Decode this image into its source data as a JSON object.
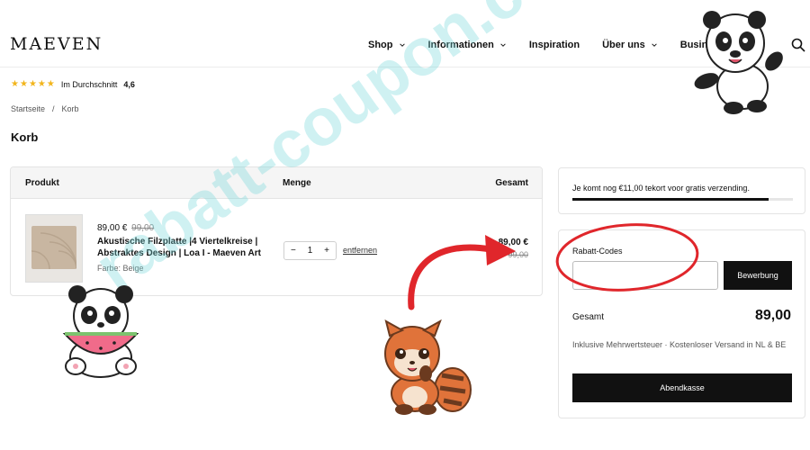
{
  "header": {
    "logo": "MAEVEN",
    "nav": [
      {
        "label": "Shop",
        "has_dropdown": true
      },
      {
        "label": "Informationen",
        "has_dropdown": true
      },
      {
        "label": "Inspiration",
        "has_dropdown": false
      },
      {
        "label": "Über uns",
        "has_dropdown": true
      },
      {
        "label": "Business",
        "has_dropdown": false
      }
    ],
    "search_icon": "search-icon"
  },
  "rating": {
    "text": "Im Durchschnitt",
    "score": "4,6",
    "stars": 5,
    "star_color": "#f2b51c"
  },
  "breadcrumb": {
    "home": "Startseite",
    "separator": "/",
    "current": "Korb"
  },
  "page": {
    "title": "Korb"
  },
  "cart": {
    "headers": {
      "product": "Produkt",
      "quantity": "Menge",
      "total": "Gesamt"
    },
    "items": [
      {
        "price": "89,00 €",
        "old_price": "99,00",
        "name": "Akustische Filzplatte |4 Viertelkreise | Abstraktes Design | Loa I - Maeven Art",
        "variant": "Farbe: Beige",
        "quantity": "1",
        "remove_label": "entfernen",
        "total": "89,00 €",
        "old_total": "99,00"
      }
    ]
  },
  "shipping": {
    "message": "Je komt nog €11,00 tekort voor gratis verzending.",
    "progress": 0.89
  },
  "summary": {
    "coupon_label": "Rabatt-Codes",
    "coupon_placeholder": "",
    "apply_label": "Bewerbung",
    "total_label": "Gesamt",
    "total_value": "89,00",
    "tax_note": "Inklusive Mehrwertsteuer · Kostenloser Versand in NL & BE",
    "checkout_label": "Abendkasse"
  },
  "overlay": {
    "watermark": "rabatt-coupon.com",
    "accent": "#e0262b"
  }
}
